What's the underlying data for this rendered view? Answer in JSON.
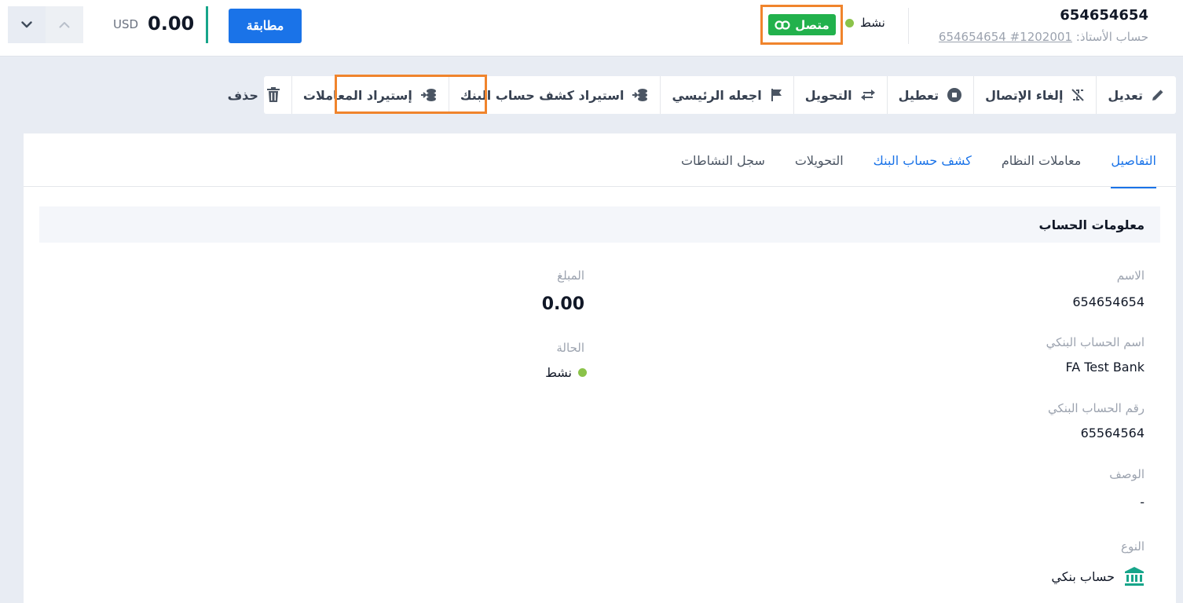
{
  "header": {
    "account_number": "654654654",
    "ledger_label": "حساب الأستاذ:",
    "ledger_link": "1202001# 654654654",
    "status_text": "نشط",
    "connected_label": "متصل",
    "match_label": "مطابقة",
    "balance": "0.00",
    "currency": "USD"
  },
  "toolbar": {
    "edit": "تعديل",
    "disconnect": "إلغاء الإتصال",
    "disable": "تعطيل",
    "transfer": "التحويل",
    "make_primary": "اجعله الرئيسي",
    "import_statement": "استيراد كشف حساب البنك",
    "import_transactions": "إستيراد المعاملات",
    "delete": "حذف"
  },
  "tabs": [
    "التفاصيل",
    "معاملات النظام",
    "كشف حساب البنك",
    "التحويلات",
    "سجل النشاطات"
  ],
  "section_title": "معلومات الحساب",
  "fields": {
    "name_label": "الاسم",
    "name_value": "654654654",
    "bank_name_label": "اسم الحساب البنكي",
    "bank_name_value": "FA Test Bank",
    "bank_number_label": "رقم الحساب البنكي",
    "bank_number_value": "65564564",
    "description_label": "الوصف",
    "description_value": "-",
    "type_label": "النوع",
    "type_value": "حساب بنكي",
    "amount_label": "المبلغ",
    "amount_value": "0.00",
    "status_label": "الحالة",
    "status_value": "نشط"
  },
  "colors": {
    "primary": "#1a73e8",
    "connected": "#22b14c",
    "highlight": "#f0842c",
    "status_dot": "#8bc34a",
    "accent_bar": "#17a58a"
  }
}
